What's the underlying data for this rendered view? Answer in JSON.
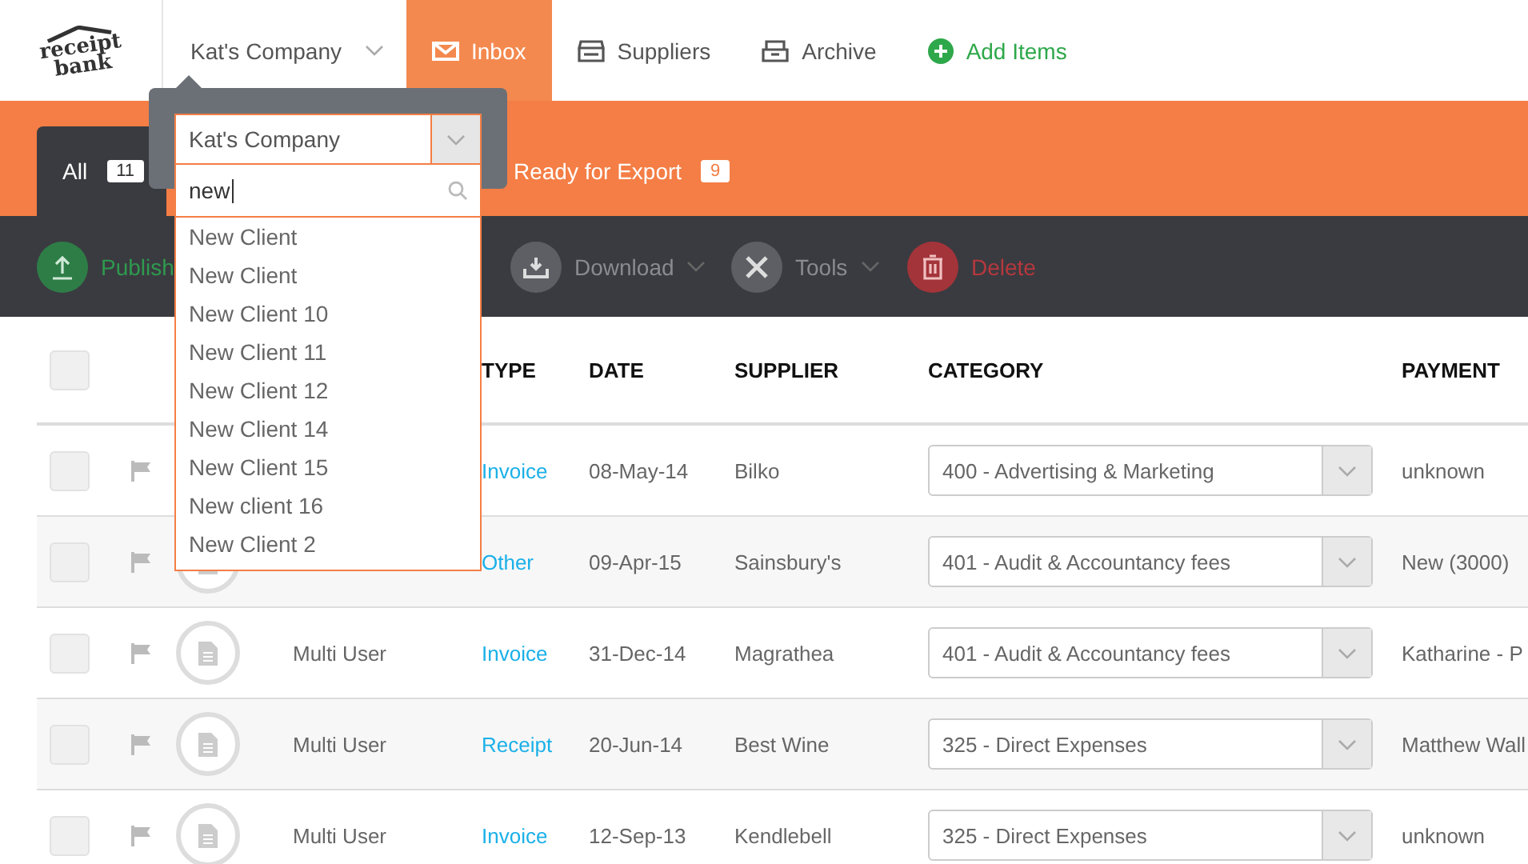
{
  "logo": {
    "line1": "receipt",
    "line2": "bank"
  },
  "nav": {
    "company": "Kat's Company",
    "items": [
      {
        "label": "Inbox",
        "kind": "mail",
        "selected": true
      },
      {
        "label": "Suppliers",
        "kind": "store",
        "selected": false
      },
      {
        "label": "Archive",
        "kind": "archive",
        "selected": false
      },
      {
        "label": "Add Items",
        "kind": "add",
        "selected": false
      }
    ]
  },
  "tabs": [
    {
      "label": "All",
      "count": "11",
      "selected": true
    },
    {
      "label": "Ready for Export",
      "count": "9",
      "selected": false
    }
  ],
  "toolbar": [
    {
      "label": "Publish",
      "kind": "publish",
      "caret": false
    },
    {
      "label": "Download",
      "kind": "download",
      "caret": true
    },
    {
      "label": "Tools",
      "kind": "tools",
      "caret": true
    },
    {
      "label": "Delete",
      "kind": "delete",
      "caret": false
    }
  ],
  "table": {
    "select_all_checked": false,
    "columns": [
      "TYPE",
      "DATE",
      "SUPPLIER",
      "CATEGORY",
      "PAYMENT"
    ],
    "rows": [
      {
        "checked": false,
        "type": "Invoice",
        "date": "08-May-14",
        "supplier": "Bilko",
        "category": "400 - Advertising & Marketing",
        "payment": "unknown"
      },
      {
        "checked": false,
        "type": "Other",
        "date": "09-Apr-15",
        "supplier": "Sainsbury's",
        "category": "401 - Audit & Accountancy fees",
        "payment": "New (3000)"
      },
      {
        "checked": false,
        "user": "Multi User",
        "type": "Invoice",
        "date": "31-Dec-14",
        "supplier": "Magrathea",
        "category": "401 - Audit & Accountancy fees",
        "payment": "Katharine - P"
      },
      {
        "checked": false,
        "user": "Multi User",
        "type": "Receipt",
        "date": "20-Jun-14",
        "supplier": "Best Wine",
        "category": "325 - Direct Expenses",
        "payment": "Matthew Wall"
      },
      {
        "checked": false,
        "user": "Multi User",
        "type": "Invoice",
        "date": "12-Sep-13",
        "supplier": "Kendlebell",
        "category": "325 - Direct Expenses",
        "payment": "unknown"
      }
    ]
  },
  "company_picker": {
    "value": "Kat's Company",
    "search": "new",
    "options": [
      "New Client",
      "New Client",
      "New Client 10",
      "New Client 11",
      "New Client 12",
      "New Client 14",
      "New Client 15",
      "New client 16",
      "New Client 2"
    ]
  }
}
